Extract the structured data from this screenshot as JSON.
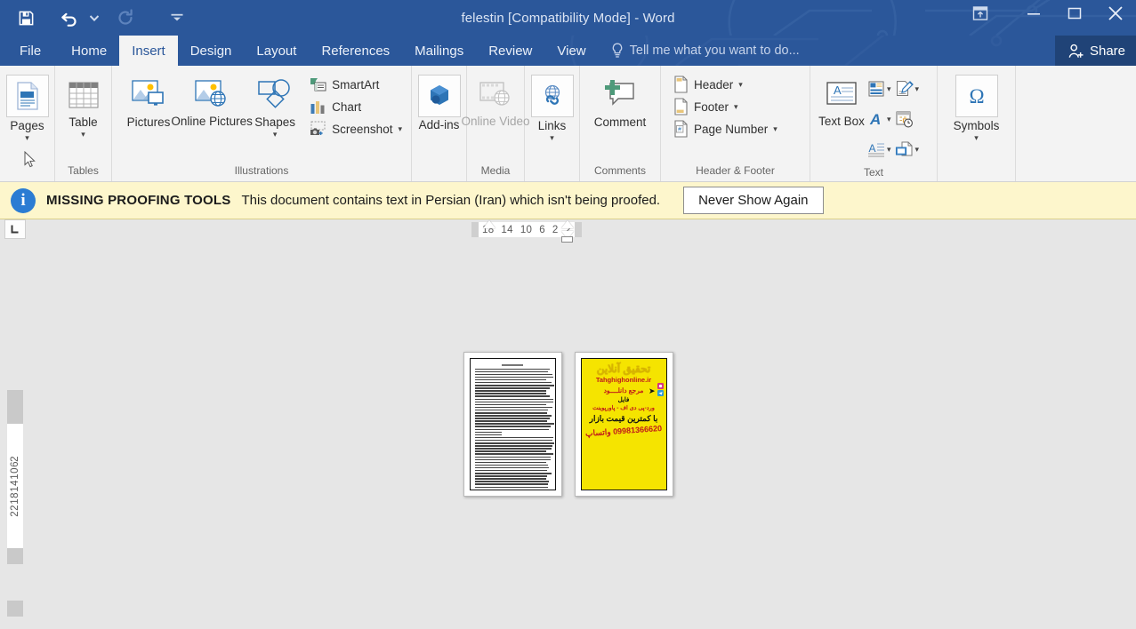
{
  "window": {
    "title": "felestin [Compatibility Mode] - Word",
    "accent_color": "#2b579a",
    "tab_active_bg": "#f3f3f3"
  },
  "quick_access": {
    "items": [
      {
        "name": "save-button",
        "icon": "save-icon",
        "label": "Save",
        "disabled": false
      },
      {
        "name": "undo-button",
        "icon": "undo-icon",
        "label": "Undo",
        "disabled": false,
        "has_dropdown": true
      },
      {
        "name": "redo-button",
        "icon": "redo-icon",
        "label": "Repeat",
        "disabled": true
      },
      {
        "name": "customize-qat-button",
        "icon": "chevron-down-icon",
        "label": "Customize Quick Access Toolbar",
        "disabled": false
      }
    ]
  },
  "window_controls": {
    "ribbon_display_options": "Ribbon Display Options",
    "minimize": "Minimize",
    "restore": "Restore Down",
    "close": "Close"
  },
  "tabs": [
    {
      "label": "File",
      "active": false
    },
    {
      "label": "Home",
      "active": false
    },
    {
      "label": "Insert",
      "active": true
    },
    {
      "label": "Design",
      "active": false
    },
    {
      "label": "Layout",
      "active": false
    },
    {
      "label": "References",
      "active": false
    },
    {
      "label": "Mailings",
      "active": false
    },
    {
      "label": "Review",
      "active": false
    },
    {
      "label": "View",
      "active": false
    }
  ],
  "tell_me": {
    "placeholder": "Tell me what you want to do...",
    "icon": "lightbulb-icon"
  },
  "share": {
    "label": "Share",
    "icon": "person-add-icon"
  },
  "ribbon": {
    "groups": [
      {
        "label": "",
        "name": "pages",
        "big_buttons": [
          {
            "label": "Pages",
            "icon": "pages-icon",
            "framed": true,
            "caret": "▾",
            "disabled": false
          }
        ]
      },
      {
        "label": "Tables",
        "name": "tables",
        "big_buttons": [
          {
            "label": "Table",
            "icon": "table-icon",
            "framed": false,
            "caret": "▾",
            "disabled": false
          }
        ]
      },
      {
        "label": "Illustrations",
        "name": "illustrations",
        "big_buttons": [
          {
            "label": "Pictures",
            "icon": "pictures-icon",
            "framed": false,
            "caret": "",
            "disabled": false
          },
          {
            "label": "Online Pictures",
            "icon": "online-pictures-icon",
            "framed": false,
            "caret": "",
            "disabled": false
          },
          {
            "label": "Shapes",
            "icon": "shapes-icon",
            "framed": false,
            "caret": "▾",
            "disabled": false
          }
        ],
        "small_buttons": [
          {
            "label": "SmartArt",
            "icon": "smartart-icon",
            "caret": ""
          },
          {
            "label": "Chart",
            "icon": "chart-icon",
            "caret": ""
          },
          {
            "label": "Screenshot",
            "icon": "screenshot-icon",
            "caret": "▾"
          }
        ]
      },
      {
        "label": "",
        "name": "add-ins",
        "big_buttons": [
          {
            "label": "Add-ins",
            "icon": "addins-icon",
            "framed": true,
            "caret": "▾",
            "disabled": false
          }
        ]
      },
      {
        "label": "Media",
        "name": "media",
        "big_buttons": [
          {
            "label": "Online Video",
            "icon": "online-video-icon",
            "framed": false,
            "caret": "",
            "disabled": true
          }
        ]
      },
      {
        "label": "",
        "name": "links",
        "big_buttons": [
          {
            "label": "Links",
            "icon": "links-icon",
            "framed": true,
            "caret": "▾",
            "disabled": false
          }
        ]
      },
      {
        "label": "Comments",
        "name": "comments",
        "big_buttons": [
          {
            "label": "Comment",
            "icon": "comment-icon",
            "framed": false,
            "caret": "",
            "disabled": false
          }
        ]
      },
      {
        "label": "Header & Footer",
        "name": "header-footer",
        "small_buttons": [
          {
            "label": "Header",
            "icon": "header-icon",
            "caret": "▾"
          },
          {
            "label": "Footer",
            "icon": "footer-icon",
            "caret": "▾"
          },
          {
            "label": "Page Number",
            "icon": "page-number-icon",
            "caret": "▾"
          }
        ]
      },
      {
        "label": "Text",
        "name": "text",
        "big_buttons": [
          {
            "label": "Text Box",
            "icon": "text-box-icon",
            "framed": false,
            "caret": "▾",
            "disabled": false
          }
        ],
        "grid_icons": [
          {
            "name": "quick-parts-icon",
            "caret": "▾"
          },
          {
            "name": "signature-line-icon",
            "caret": "▾"
          },
          {
            "name": "wordart-icon",
            "caret": "▾"
          },
          {
            "name": "date-time-icon",
            "caret": ""
          },
          {
            "name": "drop-cap-icon",
            "caret": "▾"
          },
          {
            "name": "object-icon",
            "caret": "▾"
          }
        ]
      },
      {
        "label": "",
        "name": "symbols",
        "big_buttons": [
          {
            "label": "Symbols",
            "icon": "omega-icon",
            "framed": true,
            "caret": "▾",
            "disabled": false
          }
        ]
      }
    ]
  },
  "notification": {
    "icon": "info-icon",
    "title": "MISSING PROOFING TOOLS",
    "message": "This document contains text in Persian (Iran) which isn't being proofed.",
    "button_label": "Never Show Again",
    "background": "#fdf6cc"
  },
  "rulers": {
    "tab_selector_icon": "left-tab-stop-icon",
    "horizontal_numbers": [
      "18",
      "14",
      "10",
      "6",
      "2",
      "2"
    ],
    "vertical_numbers": [
      "22",
      "18",
      "14",
      "10",
      "6",
      "2",
      "2"
    ]
  },
  "document": {
    "pages": [
      {
        "name": "page-thumbnail-1",
        "kind": "text",
        "line_count": 46
      },
      {
        "name": "page-thumbnail-2",
        "kind": "advertisement",
        "background": "#f5e400",
        "lines": {
          "logo": "تحقیق آنلاین",
          "site": "Tahghighonline.ir",
          "l1": "مرجع دانلــــود",
          "l2": "فایل",
          "l3": "ورد-پی دی اف - پاورپوینت",
          "l4": "با کمترین قیمت بازار",
          "l5": "09981366620 واتساپ"
        }
      }
    ]
  }
}
